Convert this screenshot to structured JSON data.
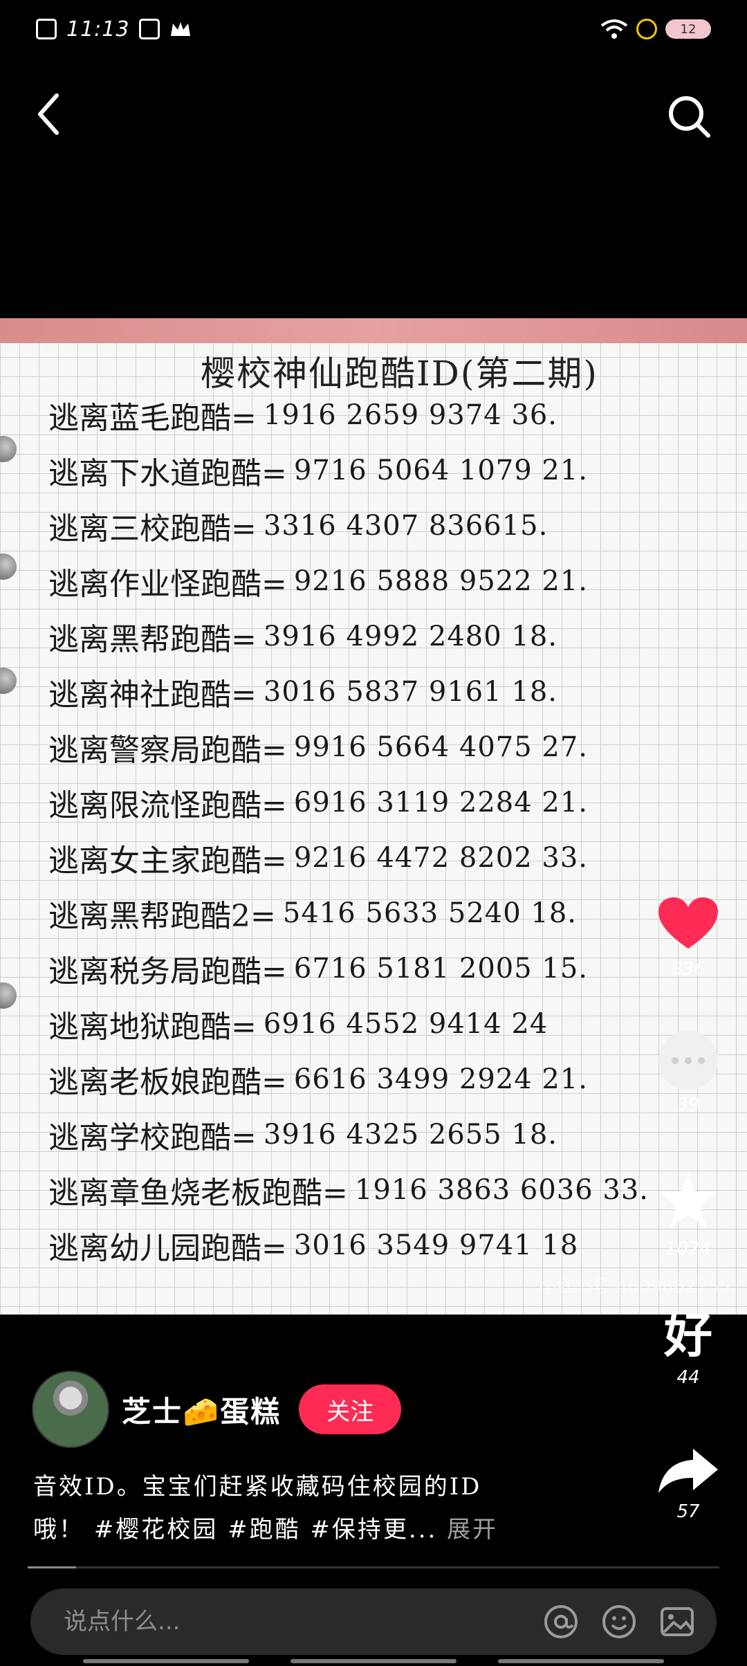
{
  "status_bar": {
    "time": "11:13",
    "battery": "12",
    "icons": [
      "close-box-icon",
      "bag-icon",
      "crown-icon",
      "wifi-icon",
      "charging-icon"
    ]
  },
  "nav": {
    "back_icon": "chevron-left-icon",
    "search_icon": "search-icon"
  },
  "post": {
    "note_title": "樱校神仙跑酷ID(第二期)",
    "note_lines": [
      {
        "name": "逃离蓝毛跑酷=",
        "code": "1916 2659 9374 36."
      },
      {
        "name": "逃离下水道跑酷=",
        "code": "9716 5064 1079 21."
      },
      {
        "name": "逃离三校跑酷=",
        "code": "3316 4307 836615."
      },
      {
        "name": "逃离作业怪跑酷=",
        "code": "9216 5888 9522 21."
      },
      {
        "name": "逃离黑帮跑酷=",
        "code": "3916 4992 2480 18."
      },
      {
        "name": "逃离神社跑酷=",
        "code": "3016 5837 9161 18."
      },
      {
        "name": "逃离警察局跑酷=",
        "code": "9916 5664 4075 27."
      },
      {
        "name": "逃离限流怪跑酷=",
        "code": "6916 3119 2284 21."
      },
      {
        "name": "逃离女主家跑酷=",
        "code": "9216 4472 8202 33."
      },
      {
        "name": "逃离黑帮跑酷2=",
        "code": "5416 5633 5240 18."
      },
      {
        "name": "逃离税务局跑酷=",
        "code": "6716 5181 2005 15."
      },
      {
        "name": "逃离地狱跑酷=",
        "code": "6916 4552 9414 24"
      },
      {
        "name": "逃离老板娘跑酷=",
        "code": "6616 3499 2924 21."
      },
      {
        "name": "逃离学校跑酷=",
        "code": "3916 4325 2655 18."
      },
      {
        "name": "逃离章鱼烧老板跑酷=",
        "code": "1916 3863 6036 33."
      },
      {
        "name": "逃离幼儿园跑酷=",
        "code": "3016 3549 9741 18"
      }
    ],
    "watermark": "小红书号 4609862755"
  },
  "actions": {
    "like": {
      "count": "836",
      "icon": "heart-icon",
      "color": "#fe2c55"
    },
    "comment": {
      "count": "39",
      "icon": "comment-icon"
    },
    "favorite": {
      "count": "1024",
      "icon": "star-icon"
    },
    "hao": {
      "mark": "好",
      "count": "44"
    },
    "share": {
      "count": "57",
      "icon": "share-icon"
    }
  },
  "author": {
    "name": "芝士🧀蛋糕",
    "follow_label": "关注"
  },
  "description": {
    "line1": "音效ID。宝宝们赶紧收藏码住校园的ID",
    "line2_prefix": "哦！",
    "tags": "#樱花校园 #跑酷 #保持更...",
    "more": "展开"
  },
  "progress": {
    "fraction": 0.07
  },
  "comment_input": {
    "placeholder": "说点什么..."
  }
}
